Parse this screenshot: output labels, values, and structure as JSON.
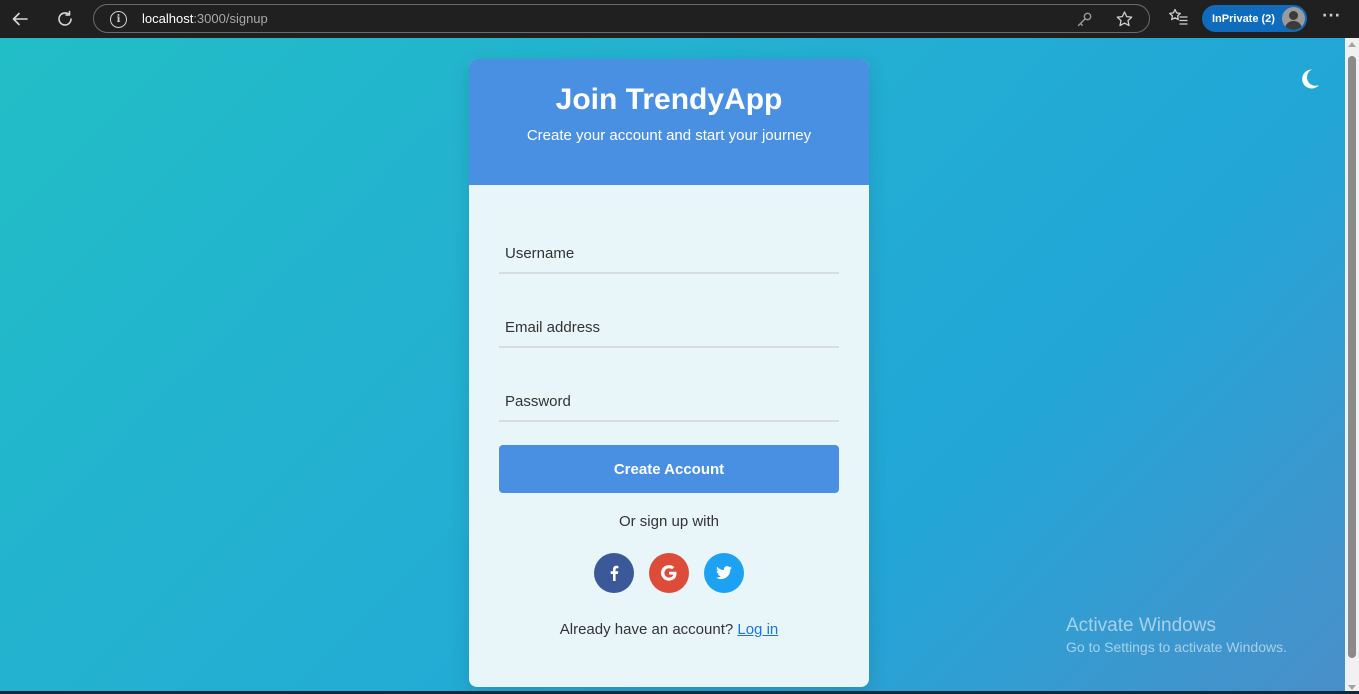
{
  "browser": {
    "url_host": "localhost",
    "url_path": ":3000/signup",
    "profile_label": "InPrivate (2)",
    "more_label": "···"
  },
  "theme_toggle": {
    "icon": "moon-icon"
  },
  "signup_card": {
    "title": "Join TrendyApp",
    "subtitle": "Create your account and start your journey",
    "username_placeholder": "Username",
    "email_placeholder": "Email address",
    "password_placeholder": "Password",
    "submit_label": "Create Account",
    "divider_text": "Or sign up with",
    "social": [
      {
        "name": "facebook",
        "glyph": "f",
        "color": "#3b5998"
      },
      {
        "name": "google",
        "glyph": "G",
        "color": "#dd4b39"
      },
      {
        "name": "twitter",
        "glyph": "bird",
        "color": "#1da1f2"
      }
    ],
    "login_prompt": "Already have an account?",
    "login_link": "Log in"
  },
  "watermark": {
    "title": "Activate Windows",
    "subtitle": "Go to Settings to activate Windows."
  },
  "colors": {
    "header_blue": "#4a90e2",
    "card_bg": "#e8f6f9",
    "link": "#1a73e8"
  }
}
